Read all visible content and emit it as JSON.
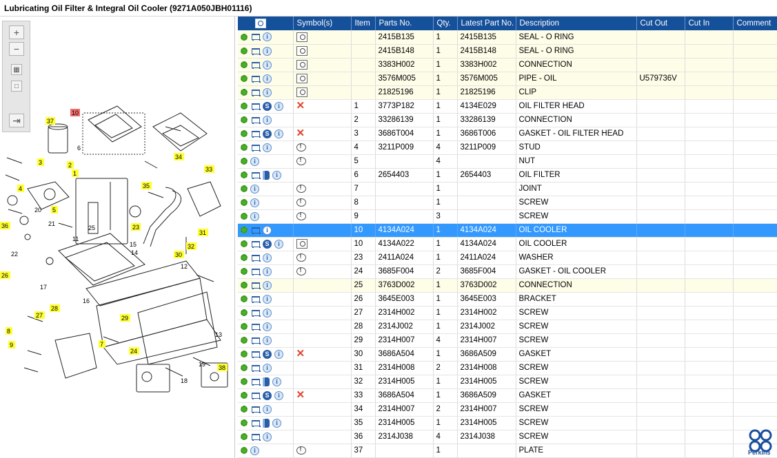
{
  "title": "Lubricating Oil Filter & Integral Oil Cooler (9271A050JBH01116)",
  "colors": {
    "header": "#15509a",
    "selected_row": "#3399ff",
    "kit_row": "#fefde8"
  },
  "toolbar": {
    "icons": [
      "zoom-in-icon",
      "zoom-out-icon",
      "fit-icon",
      "actual-size-icon",
      "expand-icon"
    ]
  },
  "diagram": {
    "callouts": [
      "37",
      "6",
      "10",
      "3",
      "2",
      "1",
      "4",
      "5",
      "36",
      "20",
      "21",
      "22",
      "11",
      "25",
      "23",
      "15",
      "14",
      "12",
      "30",
      "31",
      "32",
      "33",
      "34",
      "35",
      "26",
      "27",
      "28",
      "17",
      "18",
      "19",
      "16",
      "29",
      "24",
      "13",
      "7",
      "8",
      "9",
      "38"
    ]
  },
  "table": {
    "headers": [
      "",
      "Symbol(s)",
      "Item",
      "Parts No.",
      "Qty.",
      "Latest Part No.",
      "Description",
      "Cut Out",
      "Cut In",
      "Comment"
    ],
    "rows": [
      {
        "icons": [
          "gear",
          "cart",
          "info"
        ],
        "symbol": "mag",
        "item": "",
        "part": "2415B135",
        "qty": "1",
        "latest": "2415B135",
        "desc": "SEAL - O RING",
        "cutout": "",
        "cutin": "",
        "comment": "",
        "kind": "kit"
      },
      {
        "icons": [
          "gear",
          "cart",
          "info"
        ],
        "symbol": "mag",
        "item": "",
        "part": "2415B148",
        "qty": "1",
        "latest": "2415B148",
        "desc": "SEAL - O RING",
        "cutout": "",
        "cutin": "",
        "comment": "",
        "kind": "kit"
      },
      {
        "icons": [
          "gear",
          "cart",
          "info"
        ],
        "symbol": "mag",
        "item": "",
        "part": "3383H002",
        "qty": "1",
        "latest": "3383H002",
        "desc": "CONNECTION",
        "cutout": "",
        "cutin": "",
        "comment": "",
        "kind": "kit"
      },
      {
        "icons": [
          "gear",
          "cart",
          "info"
        ],
        "symbol": "mag",
        "item": "",
        "part": "3576M005",
        "qty": "1",
        "latest": "3576M005",
        "desc": "PIPE - OIL",
        "cutout": "U579736V",
        "cutin": "",
        "comment": "",
        "kind": "kit"
      },
      {
        "icons": [
          "gear",
          "cart",
          "info"
        ],
        "symbol": "mag",
        "item": "",
        "part": "21825196",
        "qty": "1",
        "latest": "21825196",
        "desc": "CLIP",
        "cutout": "",
        "cutin": "",
        "comment": "",
        "kind": "kit"
      },
      {
        "icons": [
          "gear",
          "cart",
          "s",
          "info"
        ],
        "symbol": "x",
        "item": "1",
        "part": "3773P182",
        "qty": "1",
        "latest": "4134E029",
        "desc": "OIL FILTER HEAD",
        "cutout": "",
        "cutin": "",
        "comment": "",
        "kind": ""
      },
      {
        "icons": [
          "gear",
          "cart",
          "info"
        ],
        "symbol": "",
        "item": "2",
        "part": "33286139",
        "qty": "1",
        "latest": "33286139",
        "desc": "CONNECTION",
        "cutout": "",
        "cutin": "",
        "comment": "",
        "kind": ""
      },
      {
        "icons": [
          "gear",
          "cart",
          "s",
          "info"
        ],
        "symbol": "x",
        "item": "3",
        "part": "3686T004",
        "qty": "1",
        "latest": "3686T006",
        "desc": "GASKET - OIL FILTER HEAD",
        "cutout": "",
        "cutin": "",
        "comment": "",
        "kind": ""
      },
      {
        "icons": [
          "gear",
          "cart",
          "info"
        ],
        "symbol": "note",
        "item": "4",
        "part": "3211P009",
        "qty": "4",
        "latest": "3211P009",
        "desc": "STUD",
        "cutout": "",
        "cutin": "",
        "comment": "",
        "kind": ""
      },
      {
        "icons": [
          "gear",
          "info"
        ],
        "symbol": "note",
        "item": "5",
        "part": "",
        "qty": "4",
        "latest": "",
        "desc": "NUT",
        "cutout": "",
        "cutin": "",
        "comment": "",
        "kind": ""
      },
      {
        "icons": [
          "gear",
          "cart",
          "book",
          "info"
        ],
        "symbol": "",
        "item": "6",
        "part": "2654403",
        "qty": "1",
        "latest": "2654403",
        "desc": "OIL FILTER",
        "cutout": "",
        "cutin": "",
        "comment": "",
        "kind": ""
      },
      {
        "icons": [
          "gear",
          "info"
        ],
        "symbol": "note",
        "item": "7",
        "part": "",
        "qty": "1",
        "latest": "",
        "desc": "JOINT",
        "cutout": "",
        "cutin": "",
        "comment": "",
        "kind": ""
      },
      {
        "icons": [
          "gear",
          "info"
        ],
        "symbol": "note",
        "item": "8",
        "part": "",
        "qty": "1",
        "latest": "",
        "desc": "SCREW",
        "cutout": "",
        "cutin": "",
        "comment": "",
        "kind": ""
      },
      {
        "icons": [
          "gear",
          "info"
        ],
        "symbol": "note",
        "item": "9",
        "part": "",
        "qty": "3",
        "latest": "",
        "desc": "SCREW",
        "cutout": "",
        "cutin": "",
        "comment": "",
        "kind": ""
      },
      {
        "icons": [
          "gear",
          "cart",
          "info"
        ],
        "symbol": "",
        "item": "10",
        "part": "4134A024",
        "qty": "1",
        "latest": "4134A024",
        "desc": "OIL COOLER",
        "cutout": "",
        "cutin": "",
        "comment": "",
        "kind": "sel"
      },
      {
        "icons": [
          "gear",
          "cart",
          "s",
          "info"
        ],
        "symbol": "mag",
        "item": "10",
        "part": "4134A022",
        "qty": "1",
        "latest": "4134A024",
        "desc": "OIL COOLER",
        "cutout": "",
        "cutin": "",
        "comment": "",
        "kind": ""
      },
      {
        "icons": [
          "gear",
          "cart",
          "info"
        ],
        "symbol": "note",
        "item": "23",
        "part": "2411A024",
        "qty": "1",
        "latest": "2411A024",
        "desc": "WASHER",
        "cutout": "",
        "cutin": "",
        "comment": "",
        "kind": ""
      },
      {
        "icons": [
          "gear",
          "cart",
          "info"
        ],
        "symbol": "note",
        "item": "24",
        "part": "3685F004",
        "qty": "2",
        "latest": "3685F004",
        "desc": "GASKET - OIL COOLER",
        "cutout": "",
        "cutin": "",
        "comment": "",
        "kind": ""
      },
      {
        "icons": [
          "gear",
          "cart",
          "info"
        ],
        "symbol": "",
        "item": "25",
        "part": "3763D002",
        "qty": "1",
        "latest": "3763D002",
        "desc": "CONNECTION",
        "cutout": "",
        "cutin": "",
        "comment": "",
        "kind": "kit"
      },
      {
        "icons": [
          "gear",
          "cart",
          "info"
        ],
        "symbol": "",
        "item": "26",
        "part": "3645E003",
        "qty": "1",
        "latest": "3645E003",
        "desc": "BRACKET",
        "cutout": "",
        "cutin": "",
        "comment": "",
        "kind": ""
      },
      {
        "icons": [
          "gear",
          "cart",
          "info"
        ],
        "symbol": "",
        "item": "27",
        "part": "2314H002",
        "qty": "1",
        "latest": "2314H002",
        "desc": "SCREW",
        "cutout": "",
        "cutin": "",
        "comment": "",
        "kind": ""
      },
      {
        "icons": [
          "gear",
          "cart",
          "info"
        ],
        "symbol": "",
        "item": "28",
        "part": "2314J002",
        "qty": "1",
        "latest": "2314J002",
        "desc": "SCREW",
        "cutout": "",
        "cutin": "",
        "comment": "",
        "kind": ""
      },
      {
        "icons": [
          "gear",
          "cart",
          "info"
        ],
        "symbol": "",
        "item": "29",
        "part": "2314H007",
        "qty": "4",
        "latest": "2314H007",
        "desc": "SCREW",
        "cutout": "",
        "cutin": "",
        "comment": "",
        "kind": ""
      },
      {
        "icons": [
          "gear",
          "cart",
          "s",
          "info"
        ],
        "symbol": "x",
        "item": "30",
        "part": "3686A504",
        "qty": "1",
        "latest": "3686A509",
        "desc": "GASKET",
        "cutout": "",
        "cutin": "",
        "comment": "",
        "kind": ""
      },
      {
        "icons": [
          "gear",
          "cart",
          "info"
        ],
        "symbol": "",
        "item": "31",
        "part": "2314H008",
        "qty": "2",
        "latest": "2314H008",
        "desc": "SCREW",
        "cutout": "",
        "cutin": "",
        "comment": "",
        "kind": ""
      },
      {
        "icons": [
          "gear",
          "cart",
          "book",
          "info"
        ],
        "symbol": "",
        "item": "32",
        "part": "2314H005",
        "qty": "1",
        "latest": "2314H005",
        "desc": "SCREW",
        "cutout": "",
        "cutin": "",
        "comment": "",
        "kind": ""
      },
      {
        "icons": [
          "gear",
          "cart",
          "s",
          "info"
        ],
        "symbol": "x",
        "item": "33",
        "part": "3686A504",
        "qty": "1",
        "latest": "3686A509",
        "desc": "GASKET",
        "cutout": "",
        "cutin": "",
        "comment": "",
        "kind": ""
      },
      {
        "icons": [
          "gear",
          "cart",
          "info"
        ],
        "symbol": "",
        "item": "34",
        "part": "2314H007",
        "qty": "2",
        "latest": "2314H007",
        "desc": "SCREW",
        "cutout": "",
        "cutin": "",
        "comment": "",
        "kind": ""
      },
      {
        "icons": [
          "gear",
          "cart",
          "book",
          "info"
        ],
        "symbol": "",
        "item": "35",
        "part": "2314H005",
        "qty": "1",
        "latest": "2314H005",
        "desc": "SCREW",
        "cutout": "",
        "cutin": "",
        "comment": "",
        "kind": ""
      },
      {
        "icons": [
          "gear",
          "cart",
          "info"
        ],
        "symbol": "",
        "item": "36",
        "part": "2314J038",
        "qty": "4",
        "latest": "2314J038",
        "desc": "SCREW",
        "cutout": "",
        "cutin": "",
        "comment": "",
        "kind": ""
      },
      {
        "icons": [
          "gear",
          "info"
        ],
        "symbol": "note",
        "item": "37",
        "part": "",
        "qty": "1",
        "latest": "",
        "desc": "PLATE",
        "cutout": "",
        "cutin": "",
        "comment": "",
        "kind": ""
      }
    ]
  },
  "brand": {
    "name": "Perkins"
  }
}
